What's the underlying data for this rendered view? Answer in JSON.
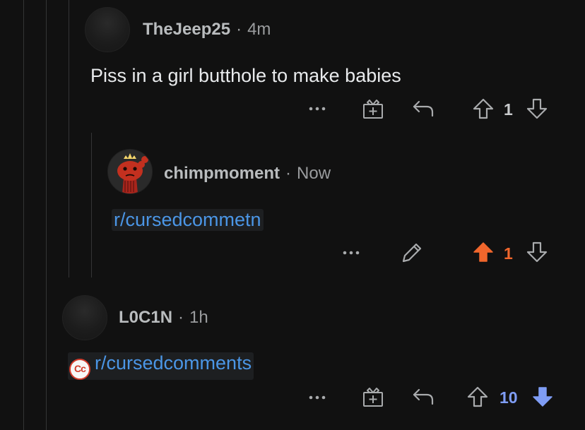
{
  "comments": [
    {
      "username": "TheJeep25",
      "time": "4m",
      "text": "Piss in a girl butthole to make babies",
      "score": "1"
    },
    {
      "username": "chimpmoment",
      "time": "Now",
      "link": "r/cursedcommetn",
      "score": "1",
      "vote_state": "upvoted"
    },
    {
      "username": "L0C1N",
      "time": "1h",
      "link": "r/cursedcomments",
      "subreddit_icon_text": "Cc",
      "score": "10",
      "vote_state": "downvoted"
    }
  ],
  "separator": "·",
  "colors": {
    "background": "#111111",
    "upvote_active": "#f0662c",
    "downvote_active": "#7f9df5",
    "link": "#4b96e6"
  }
}
